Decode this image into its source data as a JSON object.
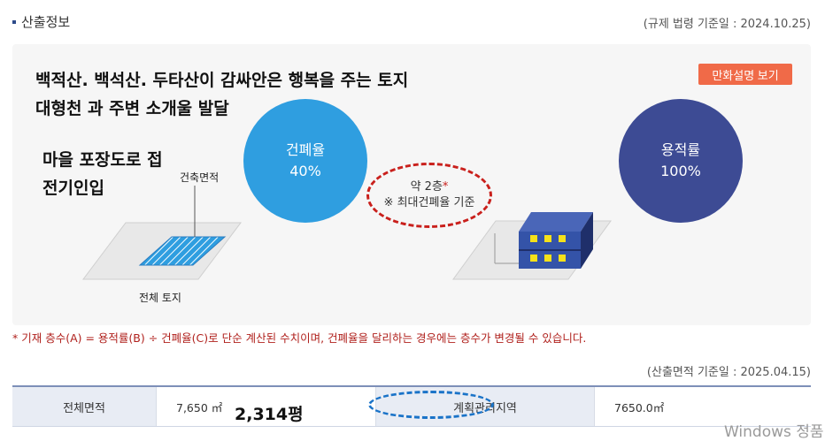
{
  "header": {
    "title": "산출정보",
    "date": "(규제 법령 기준일 : 2024.10.25)"
  },
  "overlay": {
    "line1": "백적산. 백석산. 두타산이 감싸안은 행복을 주는 토지",
    "line2": "대형천 과 주변 소개울 발달",
    "line3": "마을 포장도로 접",
    "line4": "전기인입"
  },
  "cartoon_button": {
    "label": "만화설명 보기"
  },
  "diagram": {
    "building_area_label": "건축면적",
    "total_land_label": "전체 토지",
    "bcr": {
      "title": "건폐율",
      "value": "40%"
    },
    "far": {
      "title": "용적률",
      "value": "100%"
    },
    "floors": {
      "value": "약 2층",
      "star": "*",
      "basis": "※ 최대건폐율 기준"
    }
  },
  "note": "* 기재 층수(A) = 용적률(B) ÷ 건폐율(C)로 단순 계산된 수치이며, 건폐율을 달리하는 경우에는 층수가 변경될 수 있습니다.",
  "calc_date": "(산출면적 기준일 : 2025.04.15)",
  "table": {
    "total_area_label": "전체면적",
    "total_area_value": "7,650 ㎡",
    "pyeong": "2,314평",
    "zone": "계획관리지역",
    "zone_area": "7650.0㎡"
  },
  "watermark": "Windows 정품",
  "colors": {
    "bcr": "#2f9ee0",
    "far": "#3d4b94",
    "button": "#f06a48",
    "note": "#b0211d",
    "red_annotation": "#c9201c",
    "blue_annotation": "#1a73c8"
  }
}
